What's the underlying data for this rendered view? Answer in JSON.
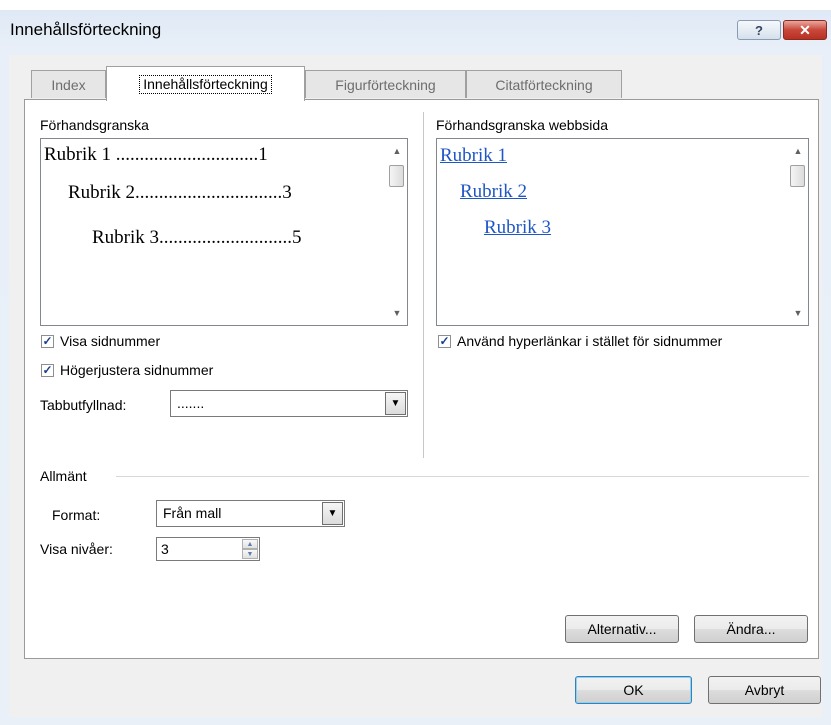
{
  "window": {
    "title": "Innehållsförteckning",
    "help_label": "?",
    "close_label": "✕"
  },
  "tabs": [
    {
      "label": "Index",
      "active": false
    },
    {
      "label": "Innehållsförteckning",
      "active": true
    },
    {
      "label": "Figurförteckning",
      "active": false
    },
    {
      "label": "Citatförteckning",
      "active": false
    }
  ],
  "print_preview": {
    "label": "Förhandsgranska",
    "lines": [
      {
        "text": "Rubrik 1 ..............................1"
      },
      {
        "text": "Rubrik 2...............................3"
      },
      {
        "text": "Rubrik 3............................5"
      }
    ]
  },
  "web_preview": {
    "label": "Förhandsgranska webbsida",
    "links": [
      "Rubrik 1",
      "Rubrik 2",
      "Rubrik 3"
    ]
  },
  "options": {
    "show_page_numbers": {
      "label": "Visa sidnummer",
      "checked": true
    },
    "right_align": {
      "label": "Högerjustera sidnummer",
      "checked": true
    },
    "tab_leader": {
      "label": "Tabbutfyllnad:",
      "value": "......."
    },
    "use_hyperlinks": {
      "label": "Använd hyperlänkar i stället för sidnummer",
      "checked": true
    }
  },
  "general": {
    "label": "Allmänt",
    "format_label": "Format:",
    "format_value": "Från mall",
    "levels_label": "Visa nivåer:",
    "levels_value": "3"
  },
  "buttons": {
    "options": "Alternativ...",
    "modify": "Ändra...",
    "ok": "OK",
    "cancel": "Avbryt"
  },
  "colors": {
    "link": "#1f56c5",
    "close_button": "#c8473a",
    "checkmark": "#1b3f8f"
  }
}
